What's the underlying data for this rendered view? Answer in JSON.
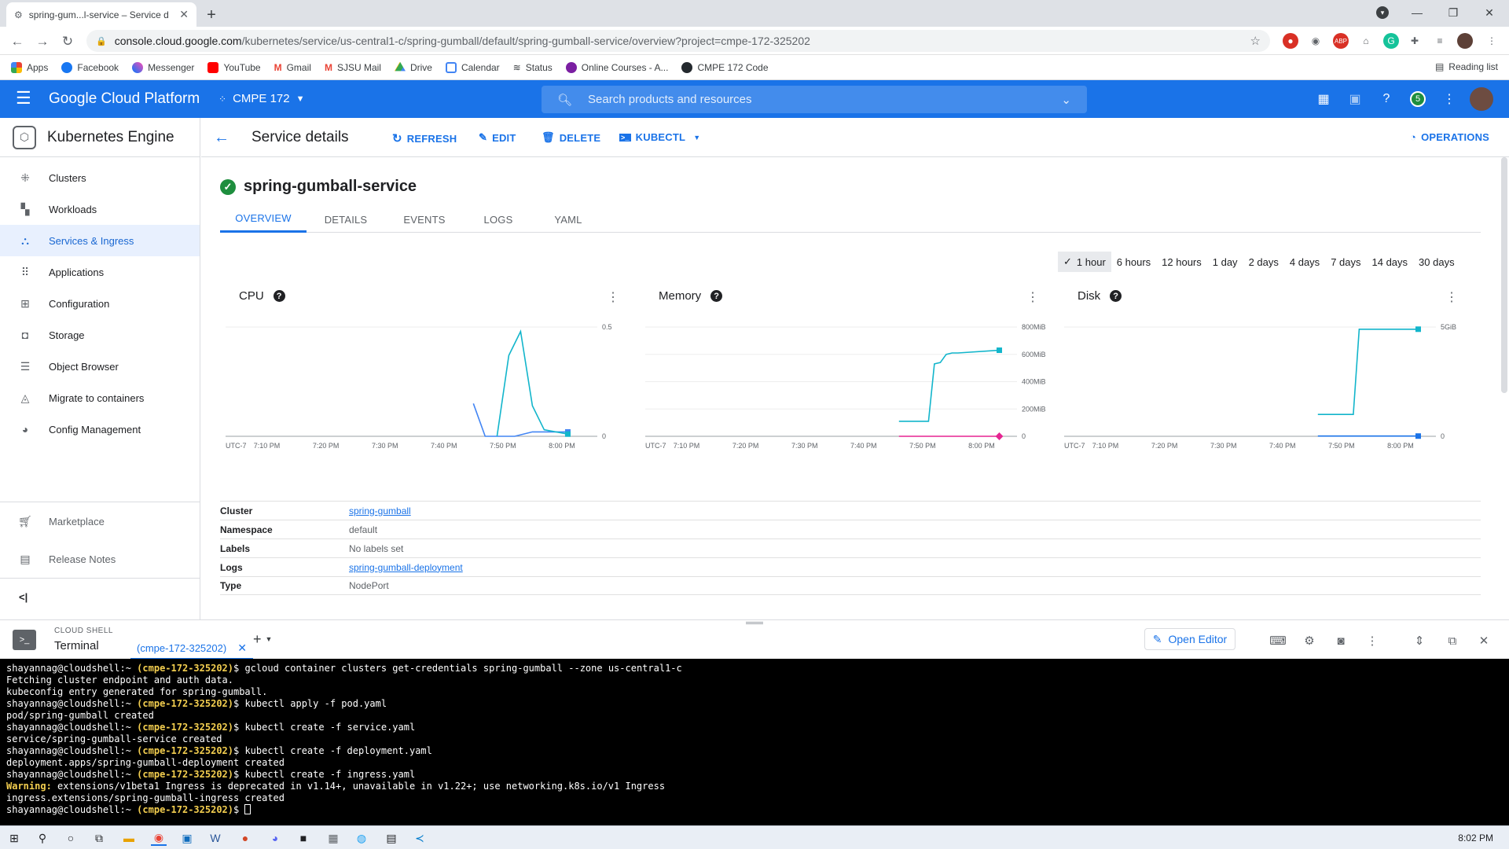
{
  "browser": {
    "tab_title": "spring-gum...l-service – Service d",
    "url_host": "console.cloud.google.com",
    "url_path": "/kubernetes/service/us-central1-c/spring-gumball/default/spring-gumball-service/overview?project=cmpe-172-325202",
    "bookmarks": [
      "Apps",
      "Facebook",
      "Messenger",
      "YouTube",
      "Gmail",
      "SJSU Mail",
      "Drive",
      "Calendar",
      "Status",
      "Online Courses - A...",
      "CMPE 172 Code"
    ],
    "reading_list": "Reading list"
  },
  "gcp": {
    "title": "Google Cloud Platform",
    "project": "CMPE 172",
    "search_placeholder": "Search products and resources",
    "notifications": "5"
  },
  "sidebar": {
    "product": "Kubernetes Engine",
    "items": [
      {
        "label": "Clusters",
        "icon": "clusters-icon"
      },
      {
        "label": "Workloads",
        "icon": "workloads-icon"
      },
      {
        "label": "Services & Ingress",
        "icon": "services-icon",
        "active": true
      },
      {
        "label": "Applications",
        "icon": "applications-icon"
      },
      {
        "label": "Configuration",
        "icon": "configuration-icon"
      },
      {
        "label": "Storage",
        "icon": "storage-icon"
      },
      {
        "label": "Object Browser",
        "icon": "object-browser-icon"
      },
      {
        "label": "Migrate to containers",
        "icon": "migrate-icon"
      },
      {
        "label": "Config Management",
        "icon": "config-management-icon"
      }
    ],
    "marketplace": "Marketplace",
    "release_notes": "Release Notes",
    "collapse": "<|"
  },
  "actions": {
    "page_title": "Service details",
    "refresh": "REFRESH",
    "edit": "EDIT",
    "delete": "DELETE",
    "kubectl": "KUBECTL",
    "operations": "OPERATIONS"
  },
  "service": {
    "name": "spring-gumball-service",
    "tabs": [
      "OVERVIEW",
      "DETAILS",
      "EVENTS",
      "LOGS",
      "YAML"
    ],
    "time_ranges": [
      "1 hour",
      "6 hours",
      "12 hours",
      "1 day",
      "2 days",
      "4 days",
      "7 days",
      "14 days",
      "30 days"
    ],
    "selected_range": "1 hour"
  },
  "charts": {
    "x_tick_labels": [
      "UTC-7",
      "7:10 PM",
      "7:20 PM",
      "7:30 PM",
      "7:40 PM",
      "7:50 PM",
      "8:00 PM"
    ]
  },
  "chart_data": [
    {
      "type": "line",
      "title": "CPU",
      "yticks": [
        "0.5",
        "0"
      ],
      "ylim": [
        0,
        0.5
      ],
      "series": [
        {
          "color": "#4285f4",
          "x": [
            "7:45 PM",
            "7:47 PM",
            "7:50 PM",
            "7:52 PM",
            "7:55 PM",
            "7:58 PM",
            "8:01 PM"
          ],
          "values": [
            0.15,
            0.0,
            0.0,
            0.0,
            0.02,
            0.02,
            0.02
          ]
        },
        {
          "color": "#12b5cb",
          "x": [
            "7:49 PM",
            "7:51 PM",
            "7:53 PM",
            "7:55 PM",
            "7:57 PM",
            "8:01 PM"
          ],
          "values": [
            0.0,
            0.37,
            0.48,
            0.14,
            0.03,
            0.01
          ]
        }
      ]
    },
    {
      "type": "line",
      "title": "Memory",
      "yticks": [
        "800MiB",
        "600MiB",
        "400MiB",
        "200MiB",
        "0"
      ],
      "ylim": [
        0,
        800
      ],
      "series": [
        {
          "color": "#12b5cb",
          "x": [
            "7:46 PM",
            "7:51 PM",
            "7:52 PM",
            "7:53 PM",
            "7:54 PM",
            "7:55 PM",
            "7:56 PM",
            "8:03 PM"
          ],
          "values": [
            110,
            110,
            530,
            540,
            600,
            610,
            610,
            630
          ]
        },
        {
          "color": "#e52592",
          "x": [
            "7:46 PM",
            "8:03 PM"
          ],
          "values": [
            0,
            0
          ]
        }
      ]
    },
    {
      "type": "line",
      "title": "Disk",
      "yticks": [
        "5GiB",
        "0"
      ],
      "ylim": [
        0,
        5
      ],
      "series": [
        {
          "color": "#12b5cb",
          "x": [
            "7:46 PM",
            "7:52 PM",
            "7:53 PM",
            "8:03 PM"
          ],
          "values": [
            1.0,
            1.0,
            4.9,
            4.9
          ]
        },
        {
          "color": "#1a73e8",
          "x": [
            "7:46 PM",
            "8:03 PM"
          ],
          "values": [
            0.01,
            0.01
          ]
        }
      ]
    }
  ],
  "details": [
    {
      "key": "Cluster",
      "value": "spring-gumball",
      "link": true
    },
    {
      "key": "Namespace",
      "value": "default",
      "link": false
    },
    {
      "key": "Labels",
      "value": "No labels set",
      "link": false
    },
    {
      "key": "Logs",
      "value": "spring-gumball-deployment",
      "link": true
    },
    {
      "key": "Type",
      "value": "NodePort",
      "link": false
    }
  ],
  "cloud_shell": {
    "label": "CLOUD SHELL",
    "terminal": "Terminal",
    "tab": "(cmpe-172-325202)",
    "open_editor": "Open Editor"
  },
  "terminal_lines": [
    {
      "kind": "prompt",
      "user": "shayannag@cloudshell:~ ",
      "proj": "(cmpe-172-325202)",
      "cmd": "$ gcloud container clusters get-credentials spring-gumball --zone us-central1-c"
    },
    {
      "kind": "out",
      "text": "Fetching cluster endpoint and auth data."
    },
    {
      "kind": "out",
      "text": "kubeconfig entry generated for spring-gumball."
    },
    {
      "kind": "prompt",
      "user": "shayannag@cloudshell:~ ",
      "proj": "(cmpe-172-325202)",
      "cmd": "$ kubectl apply -f pod.yaml"
    },
    {
      "kind": "out",
      "text": "pod/spring-gumball created"
    },
    {
      "kind": "prompt",
      "user": "shayannag@cloudshell:~ ",
      "proj": "(cmpe-172-325202)",
      "cmd": "$ kubectl create -f service.yaml"
    },
    {
      "kind": "out",
      "text": "service/spring-gumball-service created"
    },
    {
      "kind": "prompt",
      "user": "shayannag@cloudshell:~ ",
      "proj": "(cmpe-172-325202)",
      "cmd": "$ kubectl create -f deployment.yaml"
    },
    {
      "kind": "out",
      "text": "deployment.apps/spring-gumball-deployment created"
    },
    {
      "kind": "prompt",
      "user": "shayannag@cloudshell:~ ",
      "proj": "(cmpe-172-325202)",
      "cmd": "$ kubectl create -f ingress.yaml"
    },
    {
      "kind": "warn",
      "label": "Warning:",
      "text": " extensions/v1beta1 Ingress is deprecated in v1.14+, unavailable in v1.22+; use networking.k8s.io/v1 Ingress"
    },
    {
      "kind": "out",
      "text": "ingress.extensions/spring-gumball-ingress created"
    },
    {
      "kind": "prompt",
      "user": "shayannag@cloudshell:~ ",
      "proj": "(cmpe-172-325202)",
      "cmd": "$ ",
      "cursor": true
    }
  ],
  "taskbar": {
    "clock": "8:02 PM"
  }
}
